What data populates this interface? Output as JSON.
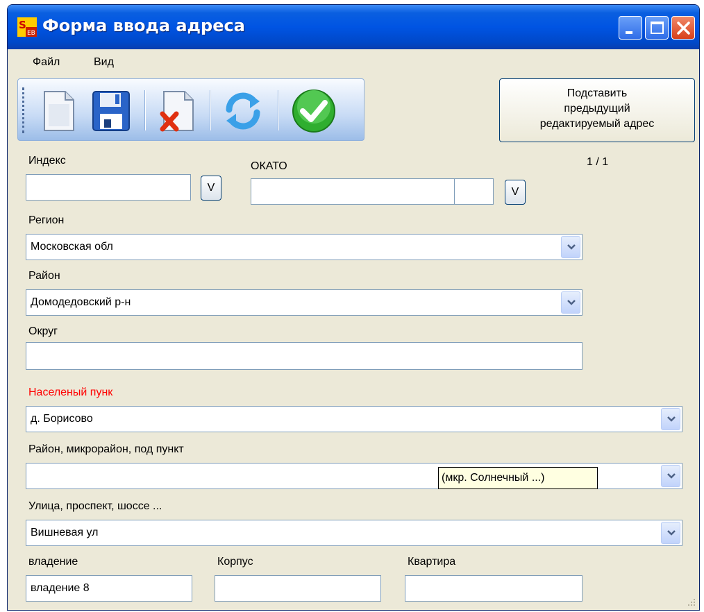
{
  "window": {
    "title": "Форма ввода адреса",
    "app_icon": "app-logo-icon",
    "controls": [
      "minimize-icon",
      "maximize-icon",
      "close-icon"
    ]
  },
  "menu": {
    "file": "Файл",
    "view": "Вид"
  },
  "toolbar": {
    "buttons": [
      "new-document-icon",
      "save-icon",
      "delete-document-icon",
      "refresh-icon",
      "confirm-check-icon"
    ]
  },
  "prev_address_button": "Подставить\nпредыдущий\nредактируемый адрес",
  "counter": "1 / 1",
  "fields": {
    "index": {
      "label": "Индекс",
      "value": "",
      "v_button": "V"
    },
    "okato": {
      "label": "ОКАТО",
      "value": "",
      "v_button": "V"
    },
    "region": {
      "label": "Регион",
      "value": "Московская обл"
    },
    "district": {
      "label": "Район",
      "value": "Домодедовский р-н"
    },
    "okrug": {
      "label": "Округ",
      "value": ""
    },
    "settlement": {
      "label": "Населеный пунк",
      "value": "д. Борисово"
    },
    "microdistrict": {
      "label": "Район, микрорайон, под пункт",
      "value": "",
      "tooltip": "(мкр. Солнечный  ...)"
    },
    "street": {
      "label": "Улица, проспект, шоссе ...",
      "value": "Вишневая ул"
    },
    "house": {
      "label": "владение",
      "value": "владение 8"
    },
    "building": {
      "label": "Корпус",
      "value": ""
    },
    "apartment": {
      "label": "Квартира",
      "value": ""
    }
  },
  "colors": {
    "title_bar": "#0054e3",
    "window_bg": "#ece9d8",
    "required_label": "#ff0000",
    "tooltip_bg": "#ffffe1"
  }
}
